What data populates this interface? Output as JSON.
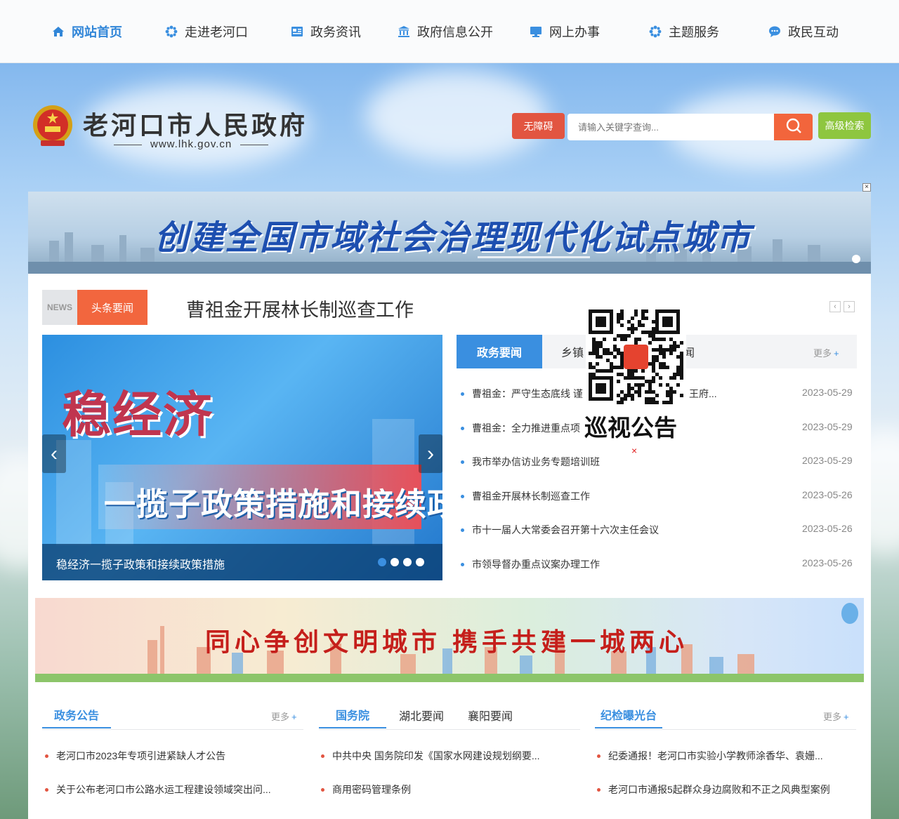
{
  "nav": {
    "items": [
      {
        "label": "网站首页",
        "icon": "home-icon",
        "active": true
      },
      {
        "label": "走进老河口",
        "icon": "flower-icon"
      },
      {
        "label": "政务资讯",
        "icon": "news-icon"
      },
      {
        "label": "政府信息公开",
        "icon": "government-building-icon"
      },
      {
        "label": "网上办事",
        "icon": "monitor-icon"
      },
      {
        "label": "主题服务",
        "icon": "flower-icon"
      },
      {
        "label": "政民互动",
        "icon": "chat-icon"
      }
    ]
  },
  "header": {
    "site_name": "老河口市人民政府",
    "site_url": "www.lhk.gov.cn",
    "accessibility_label": "无障碍",
    "search_placeholder": "请输入关键字查询...",
    "advanced_search_label": "高级检索"
  },
  "banner_top": {
    "text": "创建全国市域社会治理现代化试点城市",
    "close": "×"
  },
  "headline": {
    "tag_icon": "NEWS",
    "tag_label": "头条要闻",
    "title": "曹祖金开展林长制巡查工作",
    "prev": "‹",
    "next": "›"
  },
  "slider": {
    "title_big": "稳经济",
    "subtitle": "一揽子政策措施和接续政策",
    "caption": "稳经济一揽子政策和接续政策措施",
    "prev": "‹",
    "next": "›",
    "dots": 4,
    "active_dot": 0
  },
  "news_tabs": {
    "tabs": [
      "政务要闻",
      "乡镇",
      "闻"
    ],
    "more": "更多",
    "more_plus": "+",
    "items": [
      {
        "title": "曹祖金：严守生态底线 谨",
        "tail": "王府...",
        "date": "2023-05-29"
      },
      {
        "title": "曹祖金：全力推进重点项",
        "tail": "",
        "date": "2023-05-29"
      },
      {
        "title": "我市举办信访业务专题培训班",
        "tail": "",
        "date": "2023-05-29"
      },
      {
        "title": "曹祖金开展林长制巡查工作",
        "tail": "",
        "date": "2023-05-26"
      },
      {
        "title": "市十一届人大常委会召开第十六次主任会议",
        "tail": "",
        "date": "2023-05-26"
      },
      {
        "title": "市领导督办重点议案办理工作",
        "tail": "",
        "date": "2023-05-26"
      }
    ]
  },
  "qr_popup": {
    "title": "巡视公告",
    "close": "×"
  },
  "banner_mid": {
    "text": "同心争创文明城市  携手共建一城两心"
  },
  "sections": [
    {
      "tabs": [
        "政务公告"
      ],
      "more": "更多",
      "more_plus": "+",
      "items": [
        "老河口市2023年专项引进紧缺人才公告",
        "关于公布老河口市公路水运工程建设领域突出问..."
      ]
    },
    {
      "tabs": [
        "国务院",
        "湖北要闻",
        "襄阳要闻"
      ],
      "items": [
        "中共中央 国务院印发《国家水网建设规划纲要...",
        "商用密码管理条例"
      ]
    },
    {
      "tabs": [
        "纪检曝光台"
      ],
      "more": "更多",
      "more_plus": "+",
      "items": [
        "纪委通报！老河口市实验小学教师涂香华、袁姗...",
        "老河口市通报5起群众身边腐败和不正之风典型案例"
      ]
    }
  ],
  "colors": {
    "accent": "#3a8fe0",
    "orange": "#f2663e",
    "red": "#e25541",
    "green": "#8ec63f"
  }
}
